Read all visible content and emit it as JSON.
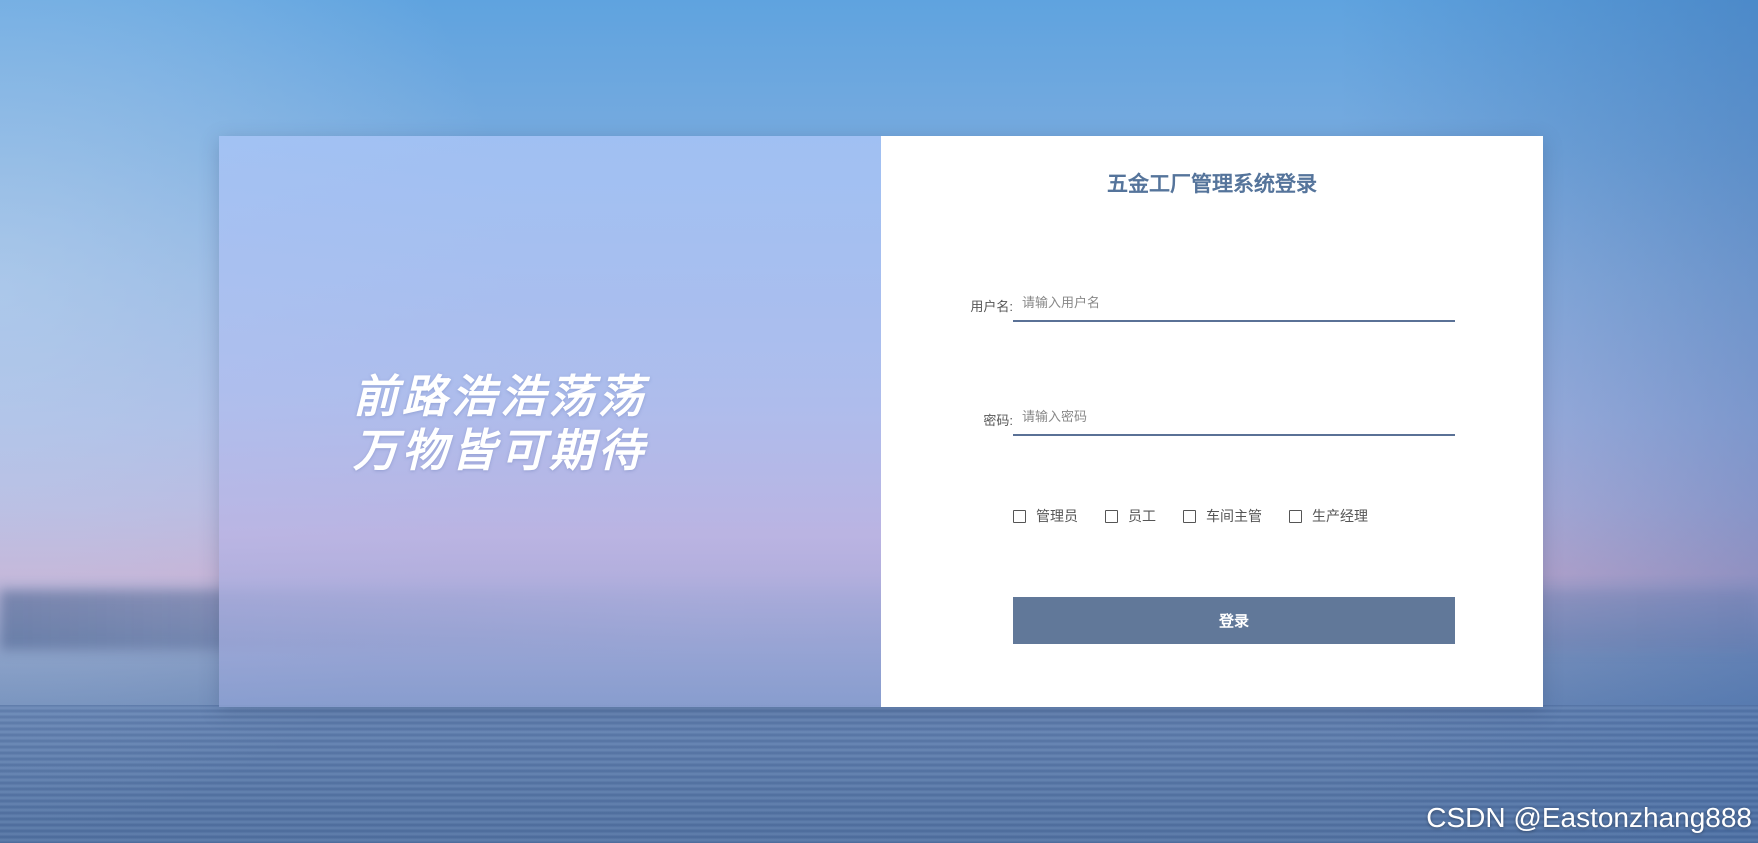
{
  "colors": {
    "accent": "#617899",
    "title": "#55749b",
    "input_underline": "#5a7196",
    "panel_background": "#ffffff"
  },
  "hero": {
    "slogan_line1": "前路浩浩荡荡",
    "slogan_line2": "万物皆可期待"
  },
  "login": {
    "title": "五金工厂管理系统登录",
    "username": {
      "label": "用户名:",
      "placeholder": "请输入用户名",
      "value": ""
    },
    "password": {
      "label": "密码:",
      "placeholder": "请输入密码",
      "value": ""
    },
    "roles": [
      {
        "label": "管理员",
        "checked": false
      },
      {
        "label": "员工",
        "checked": false
      },
      {
        "label": "车间主管",
        "checked": false
      },
      {
        "label": "生产经理",
        "checked": false
      }
    ],
    "submit_label": "登录"
  },
  "watermark": "CSDN @Eastonzhang888"
}
